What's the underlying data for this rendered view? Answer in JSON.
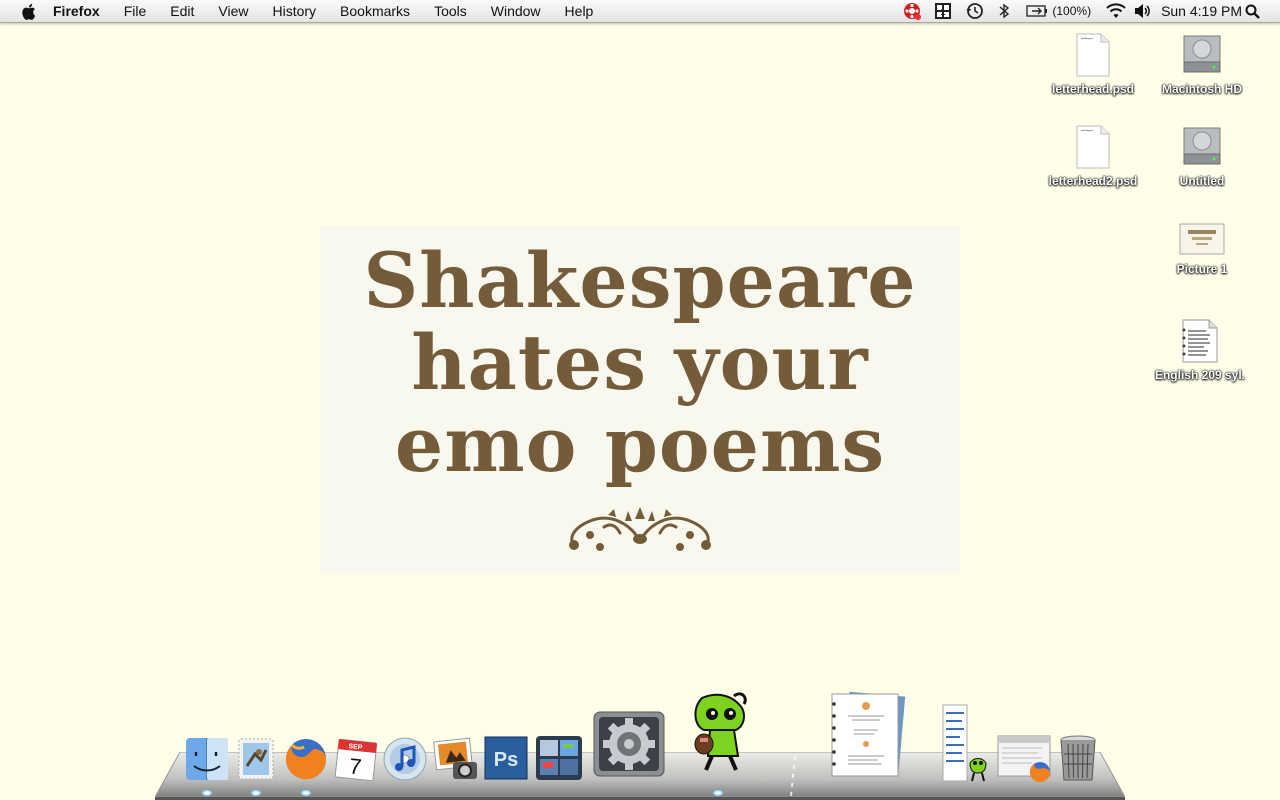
{
  "menubar": {
    "app_name": "Firefox",
    "menus": [
      "File",
      "Edit",
      "View",
      "History",
      "Bookmarks",
      "Tools",
      "Window",
      "Help"
    ],
    "battery_percent": "(100%)",
    "clock": "Sun 4:19 PM",
    "status_icons": [
      "gear-badge-icon",
      "spaces-icon",
      "time-machine-icon",
      "bluetooth-icon",
      "battery-icon",
      "wifi-icon",
      "volume-icon",
      "spotlight-icon"
    ]
  },
  "desktop_icons": [
    {
      "label": "letterhead.psd",
      "icon": "psd-file-icon"
    },
    {
      "label": "Macintosh HD",
      "icon": "hard-drive-icon"
    },
    {
      "label": "letterhead2.psd",
      "icon": "psd-file-icon"
    },
    {
      "label": "Untitled",
      "icon": "hard-drive-icon"
    },
    {
      "label": "Picture 1",
      "icon": "image-file-icon"
    },
    {
      "label": "English 209 syl.",
      "icon": "document-icon"
    }
  ],
  "wallpaper": {
    "headline_lines": [
      "Shakespeare",
      "hates your",
      "emo poems"
    ],
    "text_color": "#745c3b"
  },
  "dock": {
    "items": [
      "Finder",
      "Mail",
      "Firefox",
      "iCal",
      "iTunes",
      "iPhoto",
      "Photoshop",
      "Dashboard",
      "System Preferences",
      "Gir",
      "Documents",
      "Downloads",
      "Recent Files",
      "Trash"
    ]
  }
}
